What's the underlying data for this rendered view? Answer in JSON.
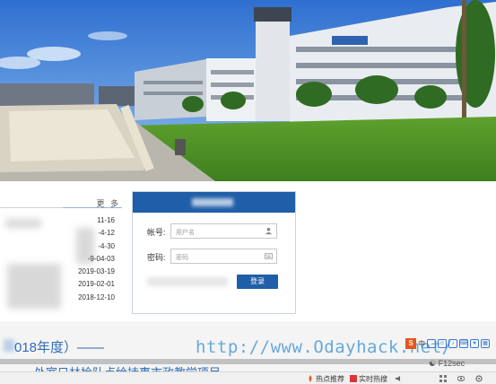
{
  "news": {
    "more_label": "更 多",
    "items": [
      {
        "date": "11-16"
      },
      {
        "date": "-4-12"
      },
      {
        "date": "-4-30"
      },
      {
        "date": "-9-04-03"
      },
      {
        "date": "2019-03-19"
      },
      {
        "date": "2019-02-01"
      },
      {
        "date": "2018-12-10"
      }
    ]
  },
  "login": {
    "account_label": "帐号:",
    "account_placeholder": "用户名",
    "password_label": "密码:",
    "password_placeholder": "密码",
    "submit_label": "登录"
  },
  "band": {
    "title": "018年度）——",
    "subtitle": "处室只林检队点给持事市政教学项目"
  },
  "watermark": "http://www.Odayhack.net/",
  "wechat_label": "F12sec",
  "ime": {
    "sogou_label": "S",
    "mode_label": "中"
  },
  "statusbar": {
    "hot_label": "热点推荐",
    "live_label": "实时热搜",
    "icons": [
      "fire-icon",
      "news-icon",
      "speaker-icon",
      "grid-icon",
      "eye-icon",
      "gear-icon"
    ]
  },
  "colors": {
    "brand_blue": "#1f5ea8",
    "link_blue": "#2f6db5",
    "watermark_blue": "#5aa3d9"
  }
}
